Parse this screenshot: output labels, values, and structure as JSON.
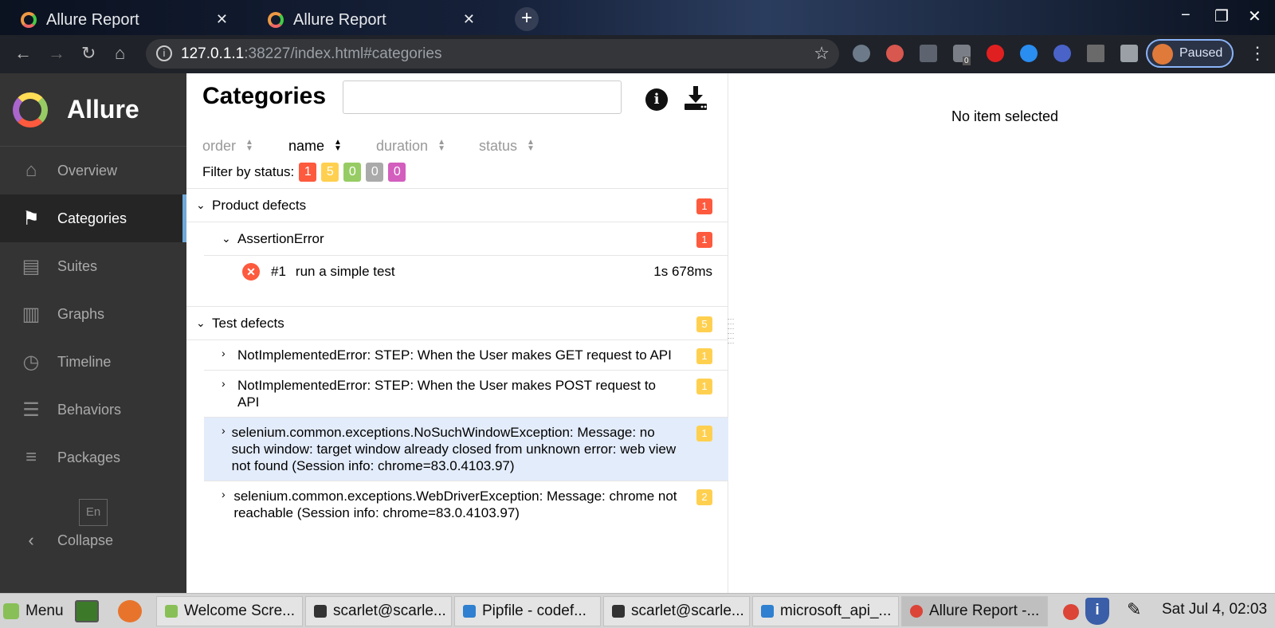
{
  "browser": {
    "tabs": [
      {
        "title": "Allure Report"
      },
      {
        "title": "Allure Report"
      }
    ],
    "new_tab_label": "+",
    "url_host": "127.0.1.1",
    "url_rest": ":38227/index.html#categories",
    "profile_label": "Paused",
    "extension_badge": "0"
  },
  "sidebar": {
    "brand": "Allure",
    "items": [
      {
        "label": "Overview",
        "icon": "home-icon",
        "glyph": "⌂"
      },
      {
        "label": "Categories",
        "icon": "flag-icon",
        "glyph": "⚑"
      },
      {
        "label": "Suites",
        "icon": "briefcase-icon",
        "glyph": "▤"
      },
      {
        "label": "Graphs",
        "icon": "bar-chart-icon",
        "glyph": "▥"
      },
      {
        "label": "Timeline",
        "icon": "clock-icon",
        "glyph": "◷"
      },
      {
        "label": "Behaviors",
        "icon": "list-icon",
        "glyph": "☰"
      },
      {
        "label": "Packages",
        "icon": "align-left-icon",
        "glyph": "≡"
      }
    ],
    "language": "En",
    "collapse": "Collapse"
  },
  "main": {
    "title": "Categories",
    "search_value": "",
    "sort_columns": [
      {
        "label": "order",
        "active": false
      },
      {
        "label": "name",
        "active": true
      },
      {
        "label": "duration",
        "active": false
      },
      {
        "label": "status",
        "active": false
      }
    ],
    "filter_label": "Filter by status:",
    "status_counts": [
      {
        "value": "1",
        "color": "#fd5a3e"
      },
      {
        "value": "5",
        "color": "#ffd050"
      },
      {
        "value": "0",
        "color": "#97cc64"
      },
      {
        "value": "0",
        "color": "#aaaaaa"
      },
      {
        "value": "0",
        "color": "#d35ebe"
      }
    ],
    "groups": [
      {
        "name": "Product defects",
        "count": "1",
        "subgroups": [
          {
            "name": "AssertionError",
            "count": "1",
            "leaf": {
              "num": "#1",
              "name": "run a simple test",
              "duration": "1s 678ms"
            }
          }
        ]
      },
      {
        "name": "Test defects",
        "count": "5",
        "subgroups": [
          {
            "name": "NotImplementedError: STEP: When the User makes GET request to API",
            "count": "1"
          },
          {
            "name": "NotImplementedError: STEP: When the User makes POST request to API",
            "count": "1"
          },
          {
            "name": "selenium.common.exceptions.NoSuchWindowException: Message: no such window: target window already closed from unknown error: web view not found (Session info: chrome=83.0.4103.97)",
            "count": "1"
          },
          {
            "name": "selenium.common.exceptions.WebDriverException: Message: chrome not reachable (Session info: chrome=83.0.4103.97)",
            "count": "2"
          }
        ]
      }
    ]
  },
  "detail": {
    "empty_text": "No item selected"
  },
  "taskbar": {
    "menu_label": "Menu",
    "items": [
      {
        "label": "Welcome Scre..."
      },
      {
        "label": "scarlet@scarle..."
      },
      {
        "label": "Pipfile - codef..."
      },
      {
        "label": "scarlet@scarle..."
      },
      {
        "label": "microsoft_api_..."
      },
      {
        "label": "Allure Report -..."
      }
    ],
    "clock": "Sat Jul  4, 02:03"
  }
}
